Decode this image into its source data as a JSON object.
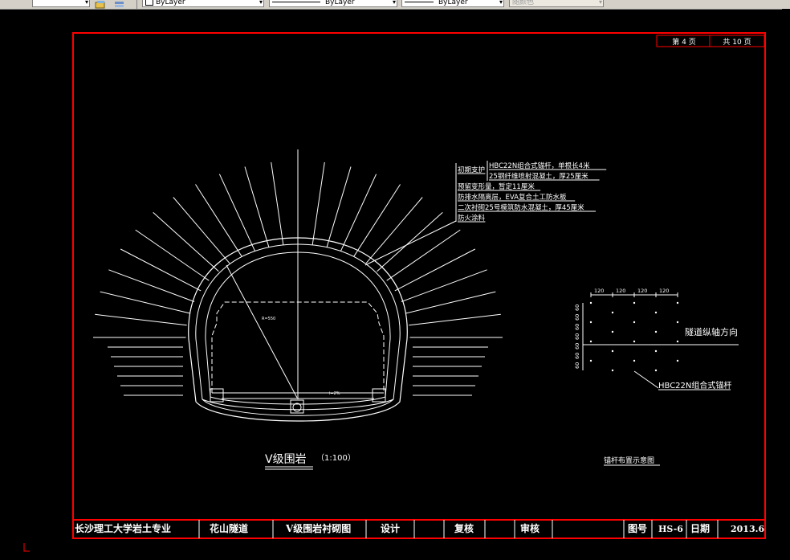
{
  "toolbar": {
    "layer_label": "ByLayer",
    "linetype_label": "ByLayer",
    "lineweight_label": "ByLayer",
    "color_label": "随颜色"
  },
  "page_counter": {
    "current_label": "第  4  页",
    "total_label": "共  10  页"
  },
  "section_drawing": {
    "layer_notes": [
      "初期支护",
      "HBC22N组合式锚杆，单根长4米",
      "25钢纤维喷射混凝土，厚25厘米",
      "预留变形量，暂定11厘米",
      "防排水隔离层，EVA复合土工防水板",
      "二次衬砌25号模筑防水混凝土，厚45厘米",
      "防火涂料"
    ],
    "radius_label": "R=550",
    "floor_label": "i=2%",
    "caption": "V级围岩",
    "scale": "（1:100）"
  },
  "bolt_layout": {
    "spacing_top": [
      "120",
      "120",
      "120",
      "120"
    ],
    "spacing_left": [
      "60",
      "60",
      "60",
      "60",
      "60",
      "60",
      "60"
    ],
    "axis_label": "隧道纵轴方向",
    "bolt_label": "HBC22N组合式锚杆",
    "caption": "锚杆布置示意图"
  },
  "title_block": {
    "school": "长沙理工大学岩土专业",
    "project": "花山隧道",
    "drawing_name": "V级围岩衬砌图",
    "design_label": "设计",
    "check_label": "复核",
    "review_label": "审核",
    "drawing_no_label": "图号",
    "drawing_no": "HS-6",
    "date_label": "日期",
    "date": "2013.6"
  },
  "colors": {
    "frame": "#ff0000",
    "lines": "#ffffff",
    "background": "#000000"
  }
}
